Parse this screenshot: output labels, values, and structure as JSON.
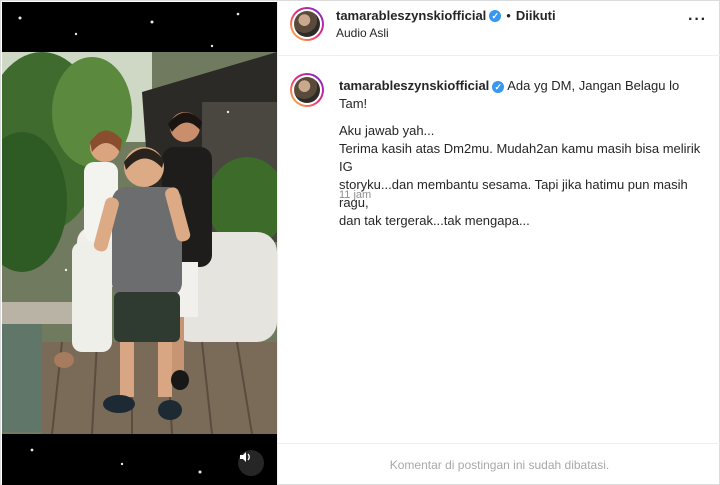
{
  "post": {
    "username": "tamarableszynskiofficial",
    "verified_mark": "✓",
    "separator": "•",
    "follow_state": "Diikuti",
    "audio": "Audio Asli",
    "more_icon": "more-options-icon"
  },
  "caption": {
    "username": "tamarableszynskiofficial",
    "first_text": "Ada yg DM, Jangan Belagu lo Tam!",
    "lines": [
      "Aku jawab yah...",
      "Terima kasih atas Dm2mu. Mudah2an kamu masih bisa melirik IG",
      "storyku...dan membantu sesama. Tapi jika hatimu pun masih ragu,",
      "dan tak tergerak...tak mengapa..."
    ],
    "time": "11 jam"
  },
  "footer": {
    "comments_disabled": "Komentar di postingan ini sudah dibatasi."
  },
  "media": {
    "audio_icon": "speaker-icon"
  },
  "colors": {
    "verified": "#3897f0",
    "muted": "#8e8e8e",
    "border": "#efefef"
  }
}
